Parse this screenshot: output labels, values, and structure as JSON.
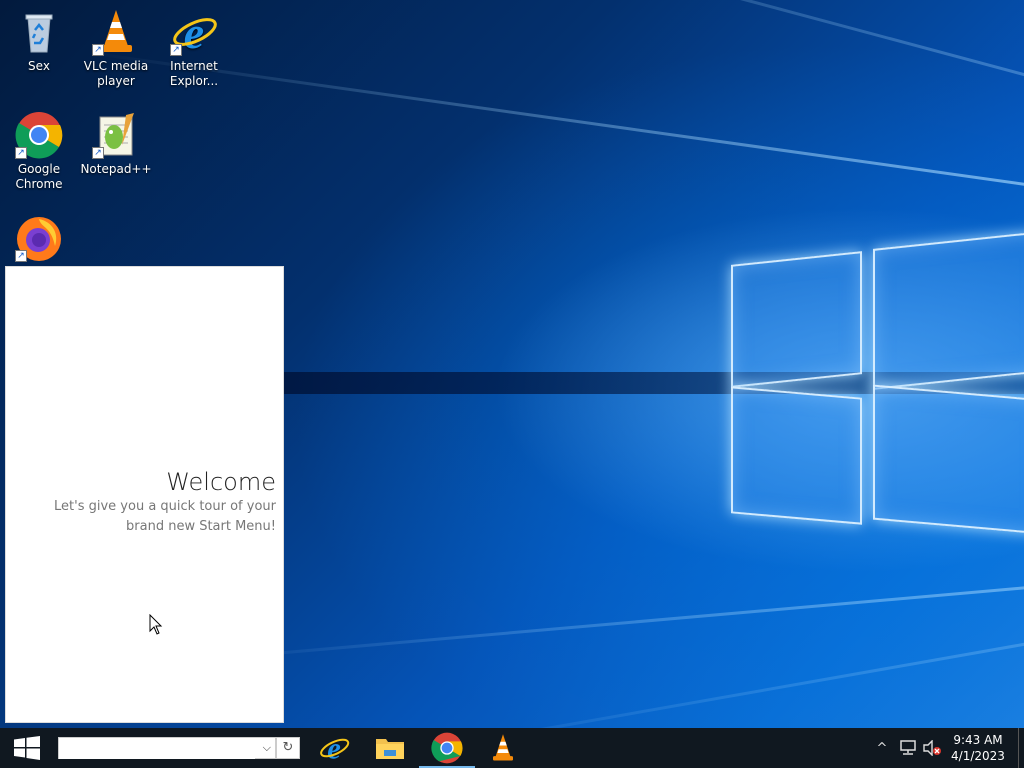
{
  "desktop_icons": [
    {
      "name": "recycle-bin",
      "label": "Sex"
    },
    {
      "name": "vlc",
      "label": "VLC media player"
    },
    {
      "name": "ie",
      "label": "Internet Explor..."
    },
    {
      "name": "chrome",
      "label": "Google Chrome"
    },
    {
      "name": "notepadpp",
      "label": "Notepad++"
    },
    {
      "name": "firefox",
      "label": ""
    }
  ],
  "welcome": {
    "title": "Welcome",
    "subtitle": "Let's give you a quick tour of your brand new Start Menu!"
  },
  "taskbar": {
    "search_value": "",
    "refresh_glyph": "↻",
    "dropdown_glyph": "⌵",
    "tray_up_glyph": "^",
    "pinned": [
      "Internet Explorer",
      "File Explorer",
      "Google Chrome",
      "VLC media player"
    ],
    "active_app": "Google Chrome",
    "clock": {
      "time": "9:43 AM",
      "date": "4/1/2023"
    }
  },
  "colors": {
    "taskbar": "#101820",
    "accent": "#76b9ed",
    "desktop": "#0554b8"
  }
}
